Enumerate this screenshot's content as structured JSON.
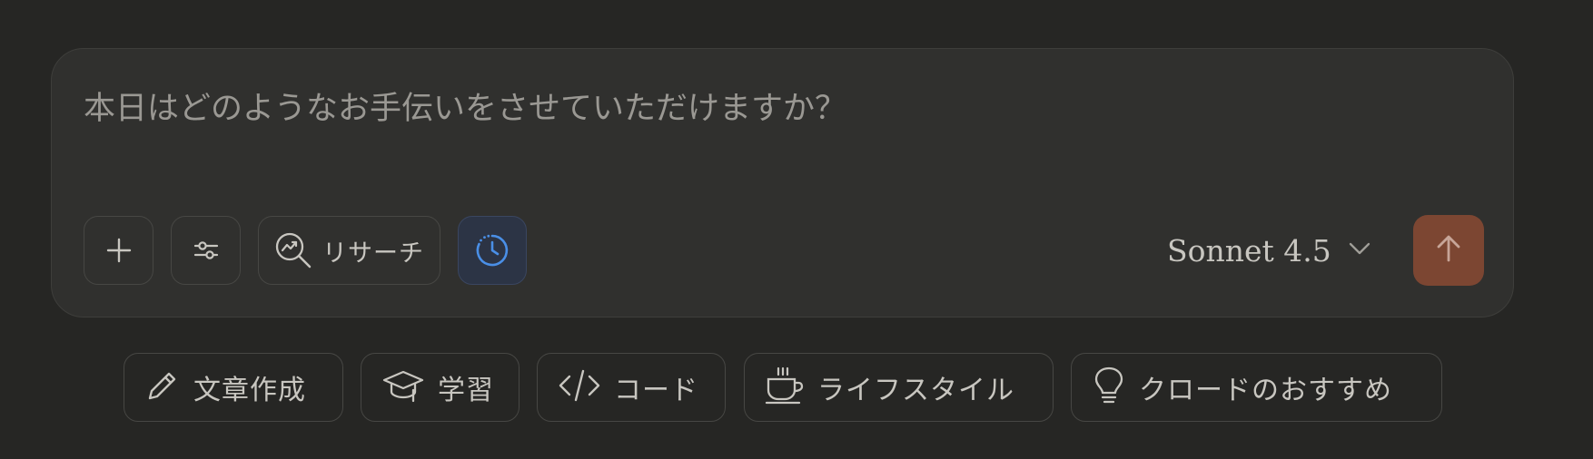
{
  "composer": {
    "placeholder": "本日はどのようなお手伝いをさせていただけますか？",
    "value": "",
    "research_label": "リサーチ",
    "model_label": "Sonnet 4.5",
    "send_color": "#7c4632",
    "extended_thinking_active": true,
    "extended_thinking_color": "#4a8fe7"
  },
  "icons": {
    "add": "plus-icon",
    "tools": "sliders-icon",
    "research": "search-trend-icon",
    "extended": "clock-icon",
    "model": "chevron-down-icon",
    "send": "arrow-up-icon"
  },
  "suggestions": [
    {
      "label": "文章作成",
      "icon": "pencil-icon"
    },
    {
      "label": "学習",
      "icon": "graduation-cap-icon"
    },
    {
      "label": "コード",
      "icon": "code-icon"
    },
    {
      "label": "ライフスタイル",
      "icon": "coffee-cup-icon"
    },
    {
      "label": "クロードのおすすめ",
      "icon": "lightbulb-icon"
    }
  ]
}
